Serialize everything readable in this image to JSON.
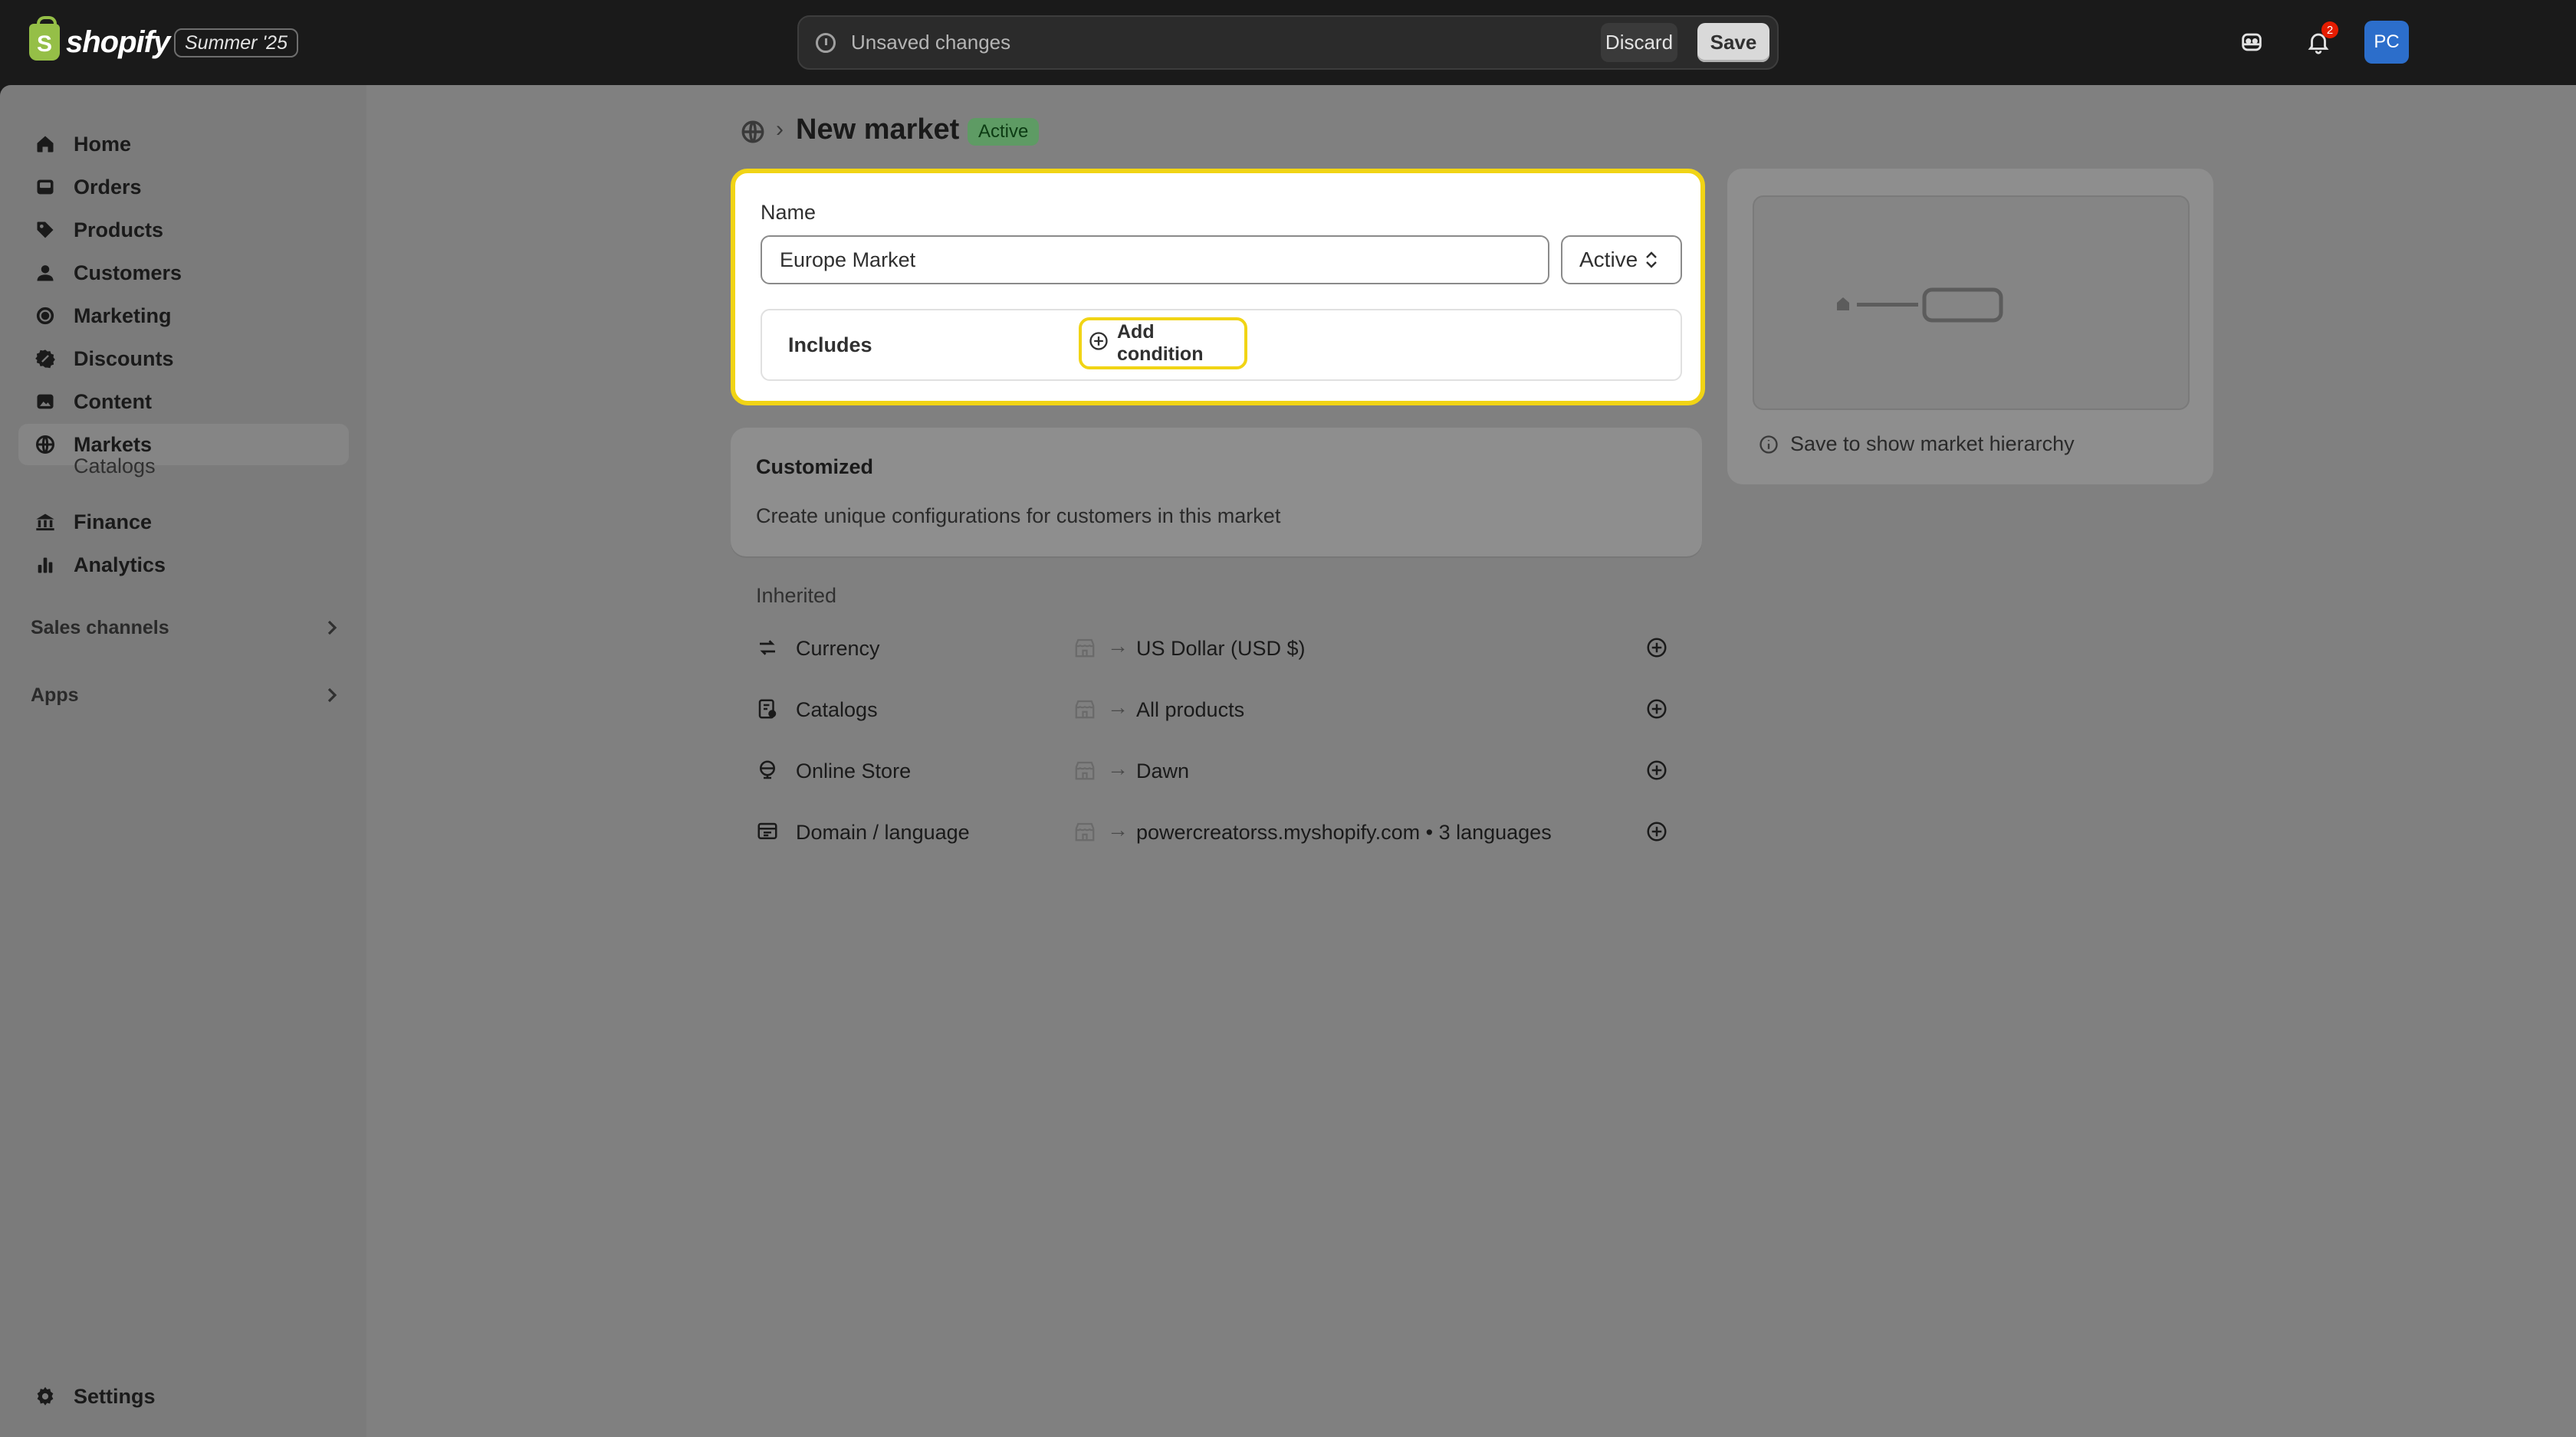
{
  "topbar": {
    "logo_text": "shopify",
    "logo_letter": "S",
    "edition_badge": "Summer '25",
    "savebar_text": "Unsaved changes",
    "discard_label": "Discard",
    "save_label": "Save",
    "notification_count": "2",
    "avatar_initials": "PC"
  },
  "sidebar": {
    "items": [
      {
        "label": "Home",
        "icon": "home-icon"
      },
      {
        "label": "Orders",
        "icon": "inbox-icon"
      },
      {
        "label": "Products",
        "icon": "tag-icon"
      },
      {
        "label": "Customers",
        "icon": "person-icon"
      },
      {
        "label": "Marketing",
        "icon": "target-icon"
      },
      {
        "label": "Discounts",
        "icon": "discount-icon"
      },
      {
        "label": "Content",
        "icon": "image-icon"
      },
      {
        "label": "Markets",
        "icon": "globe-icon"
      },
      {
        "label": "Finance",
        "icon": "bank-icon"
      },
      {
        "label": "Analytics",
        "icon": "bar-chart-icon"
      }
    ],
    "sub_item": "Catalogs",
    "sales_channels": "Sales channels",
    "apps": "Apps",
    "settings": "Settings"
  },
  "page": {
    "title": "New market",
    "status_badge": "Active"
  },
  "name_card": {
    "label": "Name",
    "value": "Europe Market",
    "status_value": "Active",
    "includes_label": "Includes",
    "add_condition_label": "Add condition"
  },
  "customized": {
    "title": "Customized",
    "description": "Create unique configurations for customers in this market"
  },
  "inherited": {
    "title": "Inherited",
    "rows": [
      {
        "label": "Currency",
        "value": "US Dollar (USD $)",
        "icon": "currency-icon"
      },
      {
        "label": "Catalogs",
        "value": "All products",
        "icon": "catalog-icon"
      },
      {
        "label": "Online Store",
        "value": "Dawn",
        "icon": "online-store-icon"
      },
      {
        "label": "Domain / language",
        "value": "powercreatorss.myshopify.com • 3 languages",
        "icon": "domain-icon"
      }
    ]
  },
  "hierarchy": {
    "note": "Save to show market hierarchy"
  },
  "colors": {
    "highlight": "#f1d415",
    "active_badge": "#5e9b64",
    "avatar": "#2c6ecb",
    "notification": "#e51c00"
  }
}
